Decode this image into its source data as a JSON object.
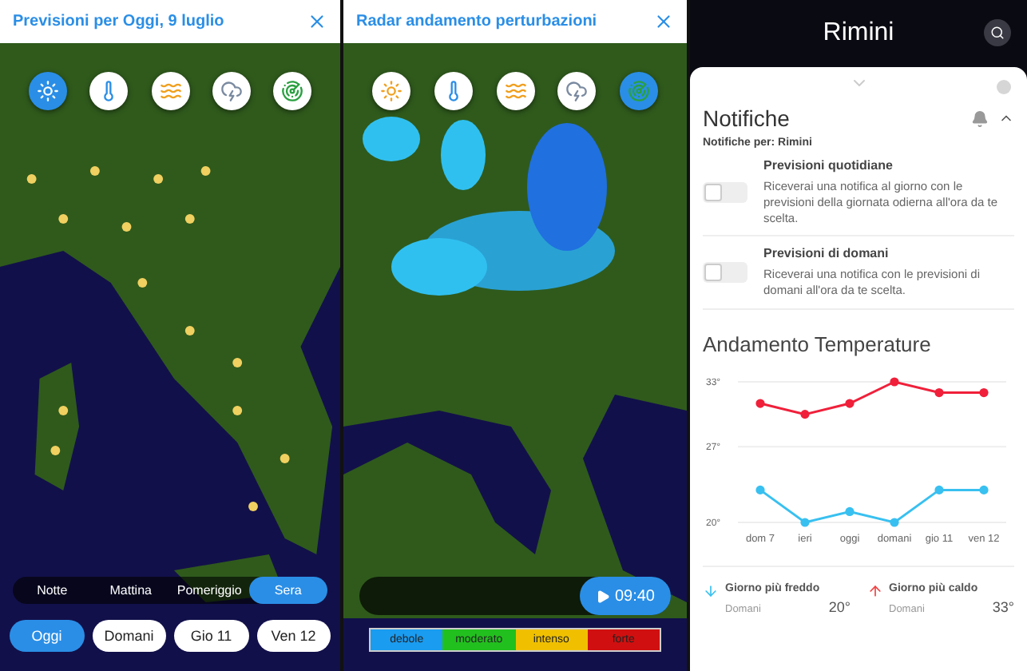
{
  "forecast_panel": {
    "title": "Previsioni per Oggi, 9 luglio",
    "layers": [
      {
        "kind": "sun",
        "selected": true
      },
      {
        "kind": "temperature",
        "selected": false
      },
      {
        "kind": "heat",
        "selected": false
      },
      {
        "kind": "sea",
        "selected": false
      },
      {
        "kind": "radar",
        "selected": false
      }
    ],
    "time_slots": [
      {
        "label": "Notte",
        "selected": false
      },
      {
        "label": "Mattina",
        "selected": false
      },
      {
        "label": "Pomeriggio",
        "selected": false
      },
      {
        "label": "Sera",
        "selected": true
      }
    ],
    "days": [
      {
        "label": "Oggi",
        "selected": true
      },
      {
        "label": "Domani",
        "selected": false
      },
      {
        "label": "Gio 11",
        "selected": false
      },
      {
        "label": "Ven 12",
        "selected": false
      }
    ]
  },
  "radar_panel": {
    "title": "Radar andamento perturbazioni",
    "layers": [
      {
        "kind": "sun",
        "selected": false
      },
      {
        "kind": "temperature",
        "selected": false
      },
      {
        "kind": "heat",
        "selected": false
      },
      {
        "kind": "sea",
        "selected": false
      },
      {
        "kind": "radar",
        "selected": true
      }
    ],
    "player": {
      "time": "09:40"
    },
    "legend": [
      {
        "label": "debole",
        "color": "#1a9cf0"
      },
      {
        "label": "moderato",
        "color": "#22c01e"
      },
      {
        "label": "intenso",
        "color": "#f0c000"
      },
      {
        "label": "forte",
        "color": "#d01010"
      }
    ]
  },
  "city_panel": {
    "title": "Rimini",
    "notifications": {
      "title": "Notifiche",
      "expanded": true,
      "subtitle": "Notifiche per: Rimini",
      "items": [
        {
          "title": "Previsioni quotidiane",
          "text": "Riceverai una notifica al giorno con le previsioni della giornata odierna all'ora da te scelta.",
          "on": false
        },
        {
          "title": "Previsioni di domani",
          "text": "Riceverai una notifica con le previsioni di domani all'ora da te scelta.",
          "on": false
        }
      ]
    },
    "temperature": {
      "title": "Andamento Temperature",
      "chart_data": {
        "type": "line",
        "categories": [
          "dom 7",
          "ieri",
          "oggi",
          "domani",
          "gio 11",
          "ven 12"
        ],
        "ylim": [
          20,
          33
        ],
        "series": [
          {
            "color": "#f0203a",
            "marker": "circle",
            "values": [
              31,
              30,
              31,
              33,
              32,
              32
            ]
          },
          {
            "color": "#38c0f0",
            "marker": "circle",
            "values": [
              23,
              20,
              21,
              20,
              23,
              23
            ]
          }
        ],
        "yticks": [
          {
            "value": 20,
            "label": "20°"
          },
          {
            "value": 27,
            "label": "27°"
          },
          {
            "value": 33,
            "label": "33°"
          }
        ]
      },
      "extremes": [
        {
          "kind": "cold",
          "label": "Giorno più freddo",
          "day": "Domani",
          "value": "20°"
        },
        {
          "kind": "hot",
          "label": "Giorno più caldo",
          "day": "Domani",
          "value": "33°"
        }
      ]
    }
  }
}
